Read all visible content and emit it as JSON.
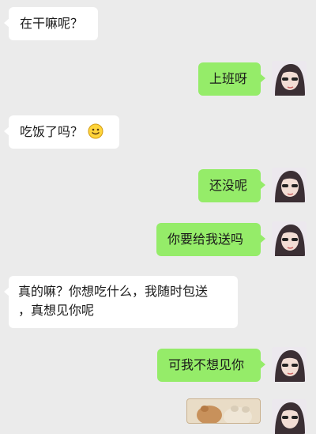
{
  "messages": [
    {
      "side": "left",
      "text": "在干嘛呢？"
    },
    {
      "side": "right",
      "text": "上班呀"
    },
    {
      "side": "left",
      "text": "吃饭了吗？",
      "icon": "smile-emoji-icon"
    },
    {
      "side": "right",
      "text": "还没呢"
    },
    {
      "side": "right",
      "text": "你要给我送吗"
    },
    {
      "side": "left",
      "line1": "真的嘛？你想吃什么，我随时包送",
      "line2": "，真想见你呢"
    },
    {
      "side": "right",
      "text": "可我不想见你"
    },
    {
      "side": "right",
      "type": "image",
      "icon": "image-thumbnail-icon"
    }
  ],
  "colors": {
    "background": "#ebebeb",
    "incoming_bubble": "#ffffff",
    "outgoing_bubble": "#95ec69"
  },
  "avatar": {
    "icon": "user-avatar-photo"
  }
}
